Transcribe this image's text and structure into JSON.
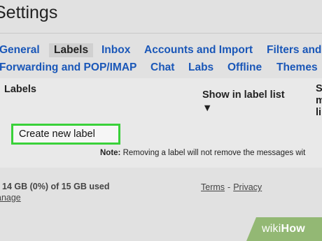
{
  "header": {
    "title": "Settings"
  },
  "tabs": {
    "row1": [
      {
        "label": "General",
        "active": false
      },
      {
        "label": "Labels",
        "active": true
      },
      {
        "label": "Inbox",
        "active": false
      },
      {
        "label": "Accounts and Import",
        "active": false
      },
      {
        "label": "Filters and",
        "active": false
      }
    ],
    "row2": [
      {
        "label": "Forwarding and POP/IMAP",
        "active": false
      },
      {
        "label": "Chat",
        "active": false
      },
      {
        "label": "Labs",
        "active": false
      },
      {
        "label": "Offline",
        "active": false
      },
      {
        "label": "Themes",
        "active": false
      }
    ]
  },
  "labels_section": {
    "heading": "Labels",
    "column_show_in_label_list": "Show in label list ▼",
    "column_cut_lines": [
      "S",
      "m",
      "li"
    ],
    "create_button": "Create new label",
    "note_prefix": "Note:",
    "note_text": " Removing a label will not remove the messages wit"
  },
  "footer": {
    "storage": "14 GB (0%) of 15 GB used",
    "manage": "anage",
    "terms": "Terms",
    "separator": "-",
    "privacy": "Privacy"
  },
  "watermark": {
    "wiki": "wiki",
    "how": "How"
  },
  "colors": {
    "background": "#e1e1e1",
    "section_background": "#e9e9e9",
    "tab_link": "#1a57b8",
    "highlight_border": "#3ad13a",
    "watermark_green": "#93b874"
  }
}
